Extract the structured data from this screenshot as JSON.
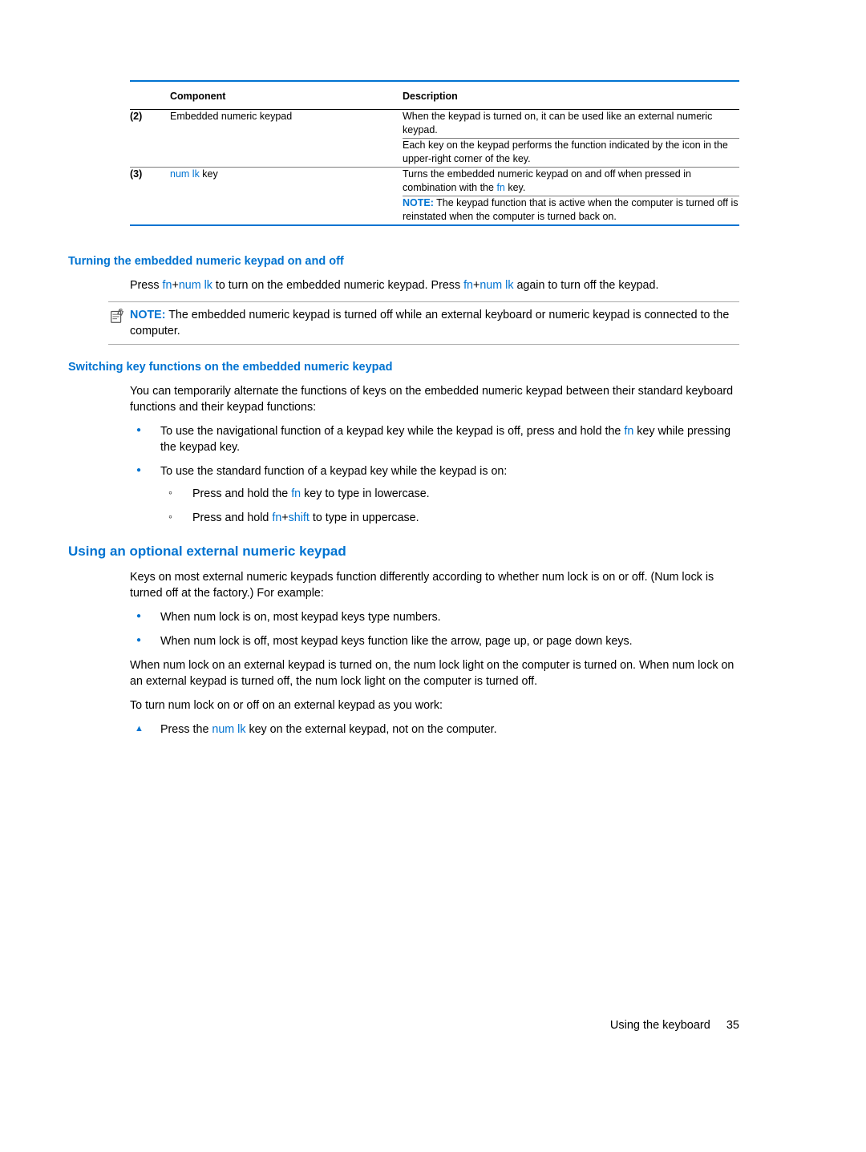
{
  "table": {
    "headers": {
      "col1": "Component",
      "col2": "Description"
    },
    "rows": [
      {
        "num": "(2)",
        "component": "Embedded numeric keypad",
        "desc1": "When the keypad is turned on, it can be used like an external numeric keypad.",
        "desc2": "Each key on the keypad performs the function indicated by the icon in the upper-right corner of the key."
      },
      {
        "num": "(3)",
        "component_pre": "",
        "component_link": "num lk",
        "component_post": " key",
        "desc1_pre": "Turns the embedded numeric keypad on and off when pressed in combination with the ",
        "desc1_link": "fn",
        "desc1_post": " key.",
        "note_label": "NOTE:",
        "note_text": "   The keypad function that is active when the computer is turned off is reinstated when the computer is turned back on."
      }
    ]
  },
  "h4_1": "Turning the embedded numeric keypad on and off",
  "p1": {
    "a": "Press ",
    "k1": "fn",
    "plus1": "+",
    "k2": "num lk",
    "b": " to turn on the embedded numeric keypad. Press ",
    "k3": "fn",
    "plus2": "+",
    "k4": "num lk",
    "c": " again to turn off the keypad."
  },
  "note1": {
    "label": "NOTE:",
    "text": "   The embedded numeric keypad is turned off while an external keyboard or numeric keypad is connected to the computer."
  },
  "h4_2": "Switching key functions on the embedded numeric keypad",
  "p2": "You can temporarily alternate the functions of keys on the embedded numeric keypad between their standard keyboard functions and their keypad functions:",
  "bullets1": {
    "b1": {
      "a": "To use the navigational function of a keypad key while the keypad is off, press and hold the ",
      "k": "fn",
      "b": " key while pressing the keypad key."
    },
    "b2": {
      "a": "To use the standard function of a keypad key while the keypad is on:",
      "s1": {
        "a": "Press and hold the ",
        "k": "fn",
        "b": " key to type in lowercase."
      },
      "s2": {
        "a": "Press and hold ",
        "k1": "fn",
        "plus": "+",
        "k2": "shift",
        "b": " to type in uppercase."
      }
    }
  },
  "h3_1": "Using an optional external numeric keypad",
  "p3": "Keys on most external numeric keypads function differently according to whether num lock is on or off. (Num lock is turned off at the factory.) For example:",
  "bullets2": {
    "b1": "When num lock is on, most keypad keys type numbers.",
    "b2": "When num lock is off, most keypad keys function like the arrow, page up, or page down keys."
  },
  "p4": "When num lock on an external keypad is turned on, the num lock light on the computer is turned on. When num lock on an external keypad is turned off, the num lock light on the computer is turned off.",
  "p5": "To turn num lock on or off on an external keypad as you work:",
  "tri1": {
    "a": "Press the ",
    "k": "num lk",
    "b": " key on the external keypad, not on the computer."
  },
  "footer": {
    "title": "Using the keyboard",
    "page": "35"
  }
}
